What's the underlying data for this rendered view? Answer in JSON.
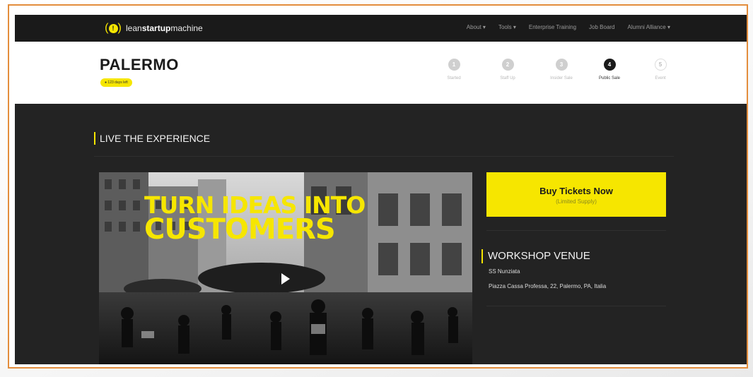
{
  "nav": {
    "logo_prefix": "lean",
    "logo_bold": "startup",
    "logo_suffix": "machine",
    "links": [
      "About ▾",
      "Tools ▾",
      "Enterprise Training",
      "Job Board",
      "Alumni Alliance ▾"
    ]
  },
  "header": {
    "city": "PALERMO",
    "badge": "● 123 days left",
    "steps": [
      {
        "num": "1",
        "label": "Started"
      },
      {
        "num": "2",
        "label": "Staff Up"
      },
      {
        "num": "3",
        "label": "Insider Sale"
      },
      {
        "num": "4",
        "label": "Public Sale"
      },
      {
        "num": "5",
        "label": "Event"
      }
    ],
    "active_step": 4
  },
  "main": {
    "section_title": "LIVE THE EXPERIENCE",
    "video": {
      "line1": "TURN IDEAS INTO",
      "line2": "CUSTOMERS"
    },
    "buy": {
      "label": "Buy Tickets Now",
      "sub": "(Limited Supply)"
    },
    "venue": {
      "title": "WORKSHOP VENUE",
      "name": "SS Nunziata",
      "address": "Piazza Cassa Professa, 22, Palermo, PA, Italia"
    }
  },
  "colors": {
    "accent": "#f6e600",
    "frame": "#e38d3c",
    "dark_bg": "#232323"
  }
}
